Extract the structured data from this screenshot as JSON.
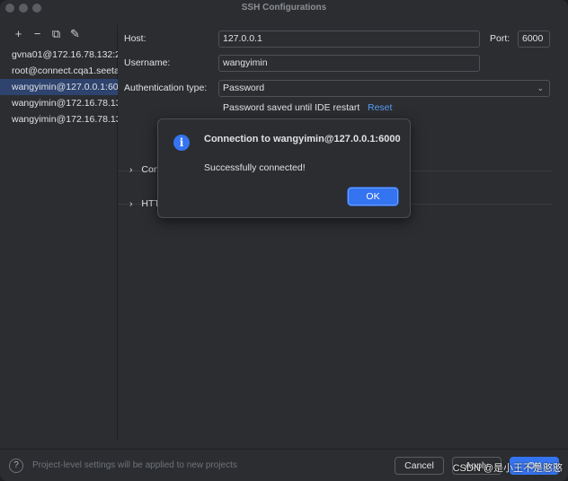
{
  "window": {
    "title": "SSH Configurations"
  },
  "toolbar": {
    "add_icon": "+",
    "remove_icon": "−",
    "copy_icon": "⧉",
    "edit_icon": "✎"
  },
  "hosts": [
    {
      "label": "gvna01@172.16.78.132:2",
      "selected": false
    },
    {
      "label": "root@connect.cqa1.seeta",
      "selected": false
    },
    {
      "label": "wangyimin@127.0.0.1:60",
      "selected": true
    },
    {
      "label": "wangyimin@172.16.78.13",
      "selected": false
    },
    {
      "label": "wangyimin@172.16.78.13",
      "selected": false
    }
  ],
  "form": {
    "host_label": "Host:",
    "host_value": "127.0.0.1",
    "port_label": "Port:",
    "port_value": "6000",
    "username_label": "Username:",
    "username_value": "wangyimin",
    "auth_label": "Authentication type:",
    "auth_value": "Password",
    "password_hint": "Password saved until IDE restart",
    "reset_link": "Reset",
    "section1": "Con",
    "section2": "HTT"
  },
  "dialog": {
    "title": "Connection to wangyimin@127.0.0.1:6000",
    "message": "Successfully connected!",
    "ok_label": "OK",
    "icon": "i"
  },
  "footer": {
    "help_icon": "?",
    "info_text": "Project-level settings will be applied to new projects",
    "cancel_label": "Cancel",
    "apply_label": "Apply",
    "ok_label": "OK"
  },
  "watermark": "CSDN @是小王不是憨憨",
  "colors": {
    "accent": "#3574f0",
    "link": "#589df6",
    "selection": "#2e436e",
    "background": "#2b2d30"
  }
}
